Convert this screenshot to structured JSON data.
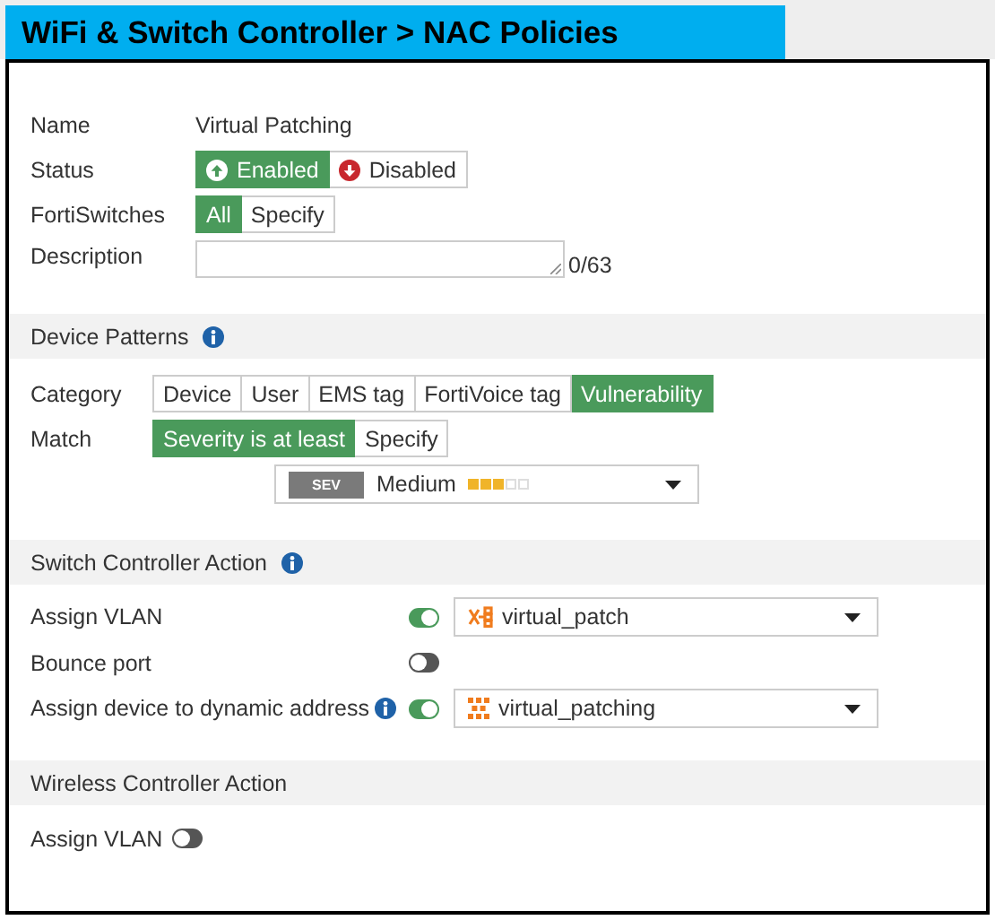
{
  "title": "WiFi & Switch Controller > NAC Policies",
  "general": [
    {
      "kind": "text",
      "label": "Name",
      "value": "Virtual Patching"
    },
    {
      "kind": "status",
      "label": "Status",
      "options": [
        {
          "label": "Enabled",
          "selected": true
        },
        {
          "label": "Disabled",
          "selected": false
        }
      ]
    },
    {
      "kind": "segmented",
      "label": "FortiSwitches",
      "options": [
        {
          "label": "All",
          "selected": true
        },
        {
          "label": "Specify",
          "selected": false
        }
      ]
    },
    {
      "kind": "textarea",
      "label": "Description",
      "counter": "0/63"
    }
  ],
  "sections": [
    {
      "kind": "patterns",
      "title": "Device Patterns",
      "info": true,
      "rows": [
        {
          "kind": "segmented",
          "label": "Category",
          "options": [
            {
              "label": "Device",
              "selected": false
            },
            {
              "label": "User",
              "selected": false
            },
            {
              "label": "EMS tag",
              "selected": false
            },
            {
              "label": "FortiVoice tag",
              "selected": false
            },
            {
              "label": "Vulnerability",
              "selected": true
            }
          ]
        },
        {
          "kind": "segmented",
          "label": "Match",
          "options": [
            {
              "label": "Severity is at least",
              "selected": true
            },
            {
              "label": "Specify",
              "selected": false
            }
          ]
        },
        {
          "kind": "severity",
          "badge": "SEV",
          "value": "Medium",
          "stars": 3
        }
      ]
    },
    {
      "kind": "switch",
      "title": "Switch Controller Action",
      "info": true,
      "rows": [
        {
          "kind": "toggle",
          "label": "Assign VLAN",
          "info": false,
          "on": true,
          "select": {
            "kind": "vlan",
            "value": "virtual_patch"
          }
        },
        {
          "kind": "toggle",
          "label": "Bounce port",
          "info": false,
          "on": false
        },
        {
          "kind": "toggle",
          "label": "Assign device to dynamic address",
          "info": true,
          "on": true,
          "select": {
            "kind": "address",
            "value": "virtual_patching"
          }
        }
      ]
    },
    {
      "kind": "wireless",
      "title": "Wireless Controller Action",
      "info": false,
      "rows": [
        {
          "kind": "toggle",
          "label": "Assign VLAN",
          "info": false,
          "on": false
        }
      ]
    }
  ]
}
